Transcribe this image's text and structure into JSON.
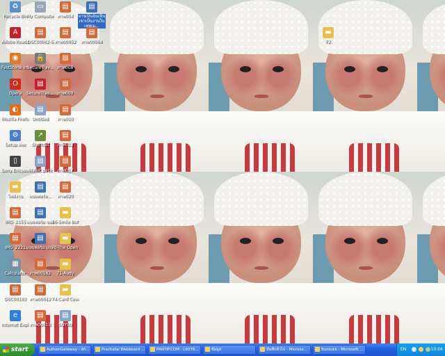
{
  "desktop": {
    "icons": [
      {
        "label": "Recycle Bin",
        "icon": "recycle-bin-icon",
        "color": "#5c8fcf",
        "glyph": "♻"
      },
      {
        "label": "My Computer",
        "icon": "computer-icon",
        "color": "#9aa6b4",
        "glyph": "▭"
      },
      {
        "label": "ภาพ004",
        "icon": "image-file-icon",
        "color": "#d46a3a",
        "glyph": "▤"
      },
      {
        "label": "อาจเป็นฉันเห็นเขาเป็นงานในเทพเม...",
        "icon": "document-icon",
        "color": "#3d6fb5",
        "glyph": "▤"
      },
      {
        "label": "Adobe Reader",
        "icon": "adobe-reader-icon",
        "color": "#c8202a",
        "glyph": "A"
      },
      {
        "label": "DSC00062-S",
        "icon": "image-file-icon",
        "color": "#d46a3a",
        "glyph": "▤"
      },
      {
        "label": "ภาพ00052",
        "icon": "image-file-icon",
        "color": "#d46a3a",
        "glyph": "▤"
      },
      {
        "label": "ภาพ00064",
        "icon": "image-file-icon",
        "color": "#d46a3a",
        "glyph": "▤"
      },
      {
        "label": "FastStone Image Viewer",
        "icon": "faststone-icon",
        "color": "#e07b22",
        "glyph": "◉"
      },
      {
        "label": "SecureTrav...",
        "icon": "lock-icon",
        "color": "#7a7a7a",
        "glyph": "🔒"
      },
      {
        "label": "ภาพ008",
        "icon": "image-file-icon",
        "color": "#d46a3a",
        "glyph": "▤"
      },
      {
        "label": "Opera",
        "icon": "opera-icon",
        "color": "#d8271c",
        "glyph": "O"
      },
      {
        "label": "SecureTrav... User's Manual",
        "icon": "pdf-icon",
        "color": "#c8202a",
        "glyph": "▤"
      },
      {
        "label": "ภาพ009",
        "icon": "image-file-icon",
        "color": "#d46a3a",
        "glyph": "▤"
      },
      {
        "label": "Mozilla Firefox",
        "icon": "firefox-icon",
        "color": "#e66b1b",
        "glyph": "◐"
      },
      {
        "label": "Untitled",
        "icon": "text-file-icon",
        "color": "#8aa4c8",
        "glyph": "▤"
      },
      {
        "label": "ภาพ010",
        "icon": "image-file-icon",
        "color": "#d46a3a",
        "glyph": "▤"
      },
      {
        "label": "Setup.exe",
        "icon": "setup-icon",
        "color": "#4a7fd0",
        "glyph": "⚙"
      },
      {
        "label": "Shortcut",
        "icon": "shortcut-icon",
        "color": "#6b8d3a",
        "glyph": "↗"
      },
      {
        "label": "ภาพ013",
        "icon": "image-file-icon",
        "color": "#d46a3a",
        "glyph": "▤"
      },
      {
        "label": "Sony Ericsson PC Suite",
        "icon": "phone-icon",
        "color": "#444",
        "glyph": "▯"
      },
      {
        "label": "Wallet pack",
        "icon": "text-file-icon",
        "color": "#8aa4c8",
        "glyph": "▤"
      },
      {
        "label": "ภาพ017",
        "icon": "image-file-icon",
        "color": "#d46a3a",
        "glyph": "▤"
      },
      {
        "label": "ไฟล์งาน",
        "icon": "folder-icon",
        "color": "#e9c04a",
        "glyph": "▬"
      },
      {
        "label": "แบบฟอร์ม...",
        "icon": "document-icon",
        "color": "#3d6fb5",
        "glyph": "▤"
      },
      {
        "label": "ภาพ020",
        "icon": "image-file-icon",
        "color": "#d46a3a",
        "glyph": "▤"
      },
      {
        "label": "IMG_2155",
        "icon": "image-file-icon",
        "color": "#d46a3a",
        "glyph": "▤"
      },
      {
        "label": "แบบฟอร์ม ขออนุมัติ",
        "icon": "document-icon",
        "color": "#3d6fb5",
        "glyph": "▤"
      },
      {
        "label": "56-Smile Buffalo",
        "icon": "folder-icon",
        "color": "#e9c04a",
        "glyph": "▬"
      },
      {
        "label": "IMG_2221",
        "icon": "image-file-icon",
        "color": "#d46a3a",
        "glyph": "▤"
      },
      {
        "label": "แบบฟอร์ม ประเมินผล",
        "icon": "document-icon",
        "color": "#3d6fb5",
        "glyph": "▤"
      },
      {
        "label": "70-The Open Project",
        "icon": "folder-icon",
        "color": "#e9c04a",
        "glyph": "▬"
      },
      {
        "label": "Calculator",
        "icon": "calculator-icon",
        "color": "#7d8ea3",
        "glyph": "▦"
      },
      {
        "label": "ภาพ00182",
        "icon": "image-file-icon",
        "color": "#d46a3a",
        "glyph": "▤"
      },
      {
        "label": "71-Audy",
        "icon": "folder-icon",
        "color": "#e9c04a",
        "glyph": "▬"
      },
      {
        "label": "DSC00183",
        "icon": "image-file-icon",
        "color": "#d46a3a",
        "glyph": "▤"
      },
      {
        "label": "ภาพ00012",
        "icon": "image-file-icon",
        "color": "#d46a3a",
        "glyph": "▤"
      },
      {
        "label": "74-Card Cover",
        "icon": "folder-icon",
        "color": "#e9c04a",
        "glyph": "▬"
      },
      {
        "label": "Internet Explorer",
        "icon": "internet-explorer-icon",
        "color": "#2f7fd8",
        "glyph": "e"
      },
      {
        "label": "ภาพ00013",
        "icon": "image-file-icon",
        "color": "#d46a3a",
        "glyph": "▤"
      },
      {
        "label": "SOYSU",
        "icon": "text-file-icon",
        "color": "#8aa4c8",
        "glyph": "▤"
      },
      {
        "label": "F2",
        "icon": "folder-icon",
        "color": "#e9c04a",
        "glyph": "▬"
      }
    ]
  },
  "taskbar": {
    "start_label": "start",
    "tasks": [
      {
        "label": "AuthenGateway - Wi..."
      },
      {
        "label": "Prachatai Webboard ..."
      },
      {
        "label": "PANTIP.COM : L9378..."
      },
      {
        "label": "ข้อมูล"
      },
      {
        "label": "บันทึกทั่วไป - Microso..."
      },
      {
        "label": "Buntukk - Microsoft ..."
      }
    ],
    "tray": {
      "language": "EN",
      "clock": "10:04"
    }
  }
}
